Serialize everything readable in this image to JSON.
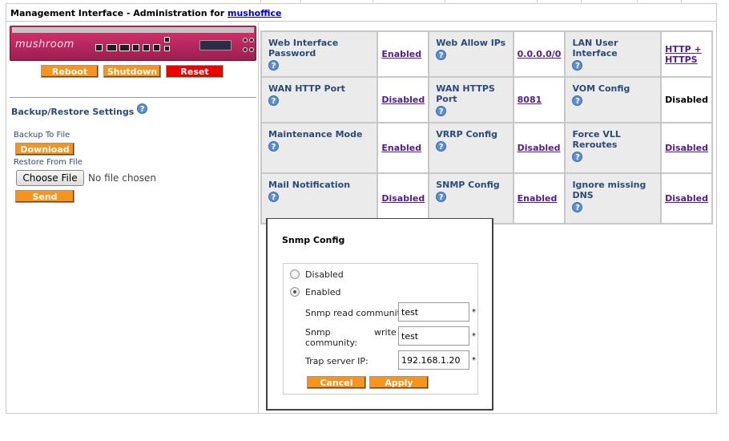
{
  "title": {
    "prefix": "Management Interface - Administration for",
    "host": "mushoffice"
  },
  "device": {
    "brand": "mushroom"
  },
  "device_buttons": {
    "reboot": "Reboot",
    "shutdown": "Shutdown",
    "reset": "Reset"
  },
  "backup": {
    "title": "Backup/Restore Settings",
    "backup_label": "Backup To File",
    "download": "Download",
    "restore_label": "Restore From File",
    "choose_file": "Choose File",
    "no_file": "No file chosen",
    "send": "Send"
  },
  "settings": [
    [
      {
        "name": "Web Interface Password",
        "value": "Enabled"
      },
      {
        "name": "Web Allow IPs",
        "value": "0.0.0.0/0"
      },
      {
        "name": "LAN User Interface",
        "value": "HTTP + HTTPS"
      }
    ],
    [
      {
        "name": "WAN HTTP Port",
        "value": "Disabled"
      },
      {
        "name": "WAN HTTPS Port",
        "value": "8081"
      },
      {
        "name": "VOM Config",
        "value": "Disabled"
      }
    ],
    [
      {
        "name": "Maintenance Mode",
        "value": "Enabled"
      },
      {
        "name": "VRRP Config",
        "value": "Disabled"
      },
      {
        "name": "Force VLL Reroutes",
        "value": "Disabled"
      }
    ],
    [
      {
        "name": "Mail Notification",
        "value": "Disabled"
      },
      {
        "name": "SNMP Config",
        "value": "Enabled"
      },
      {
        "name": "Ignore missing DNS",
        "value": "Disabled"
      }
    ]
  ],
  "help_icon": "?",
  "snmp": {
    "title": "Snmp Config",
    "opt_disabled": "Disabled",
    "opt_enabled": "Enabled",
    "read_label": "Snmp read community:",
    "read_value": "test",
    "write_label_a": "Snmp",
    "write_label_b": "write",
    "write_label_c": "community:",
    "write_value": "test",
    "trap_label": "Trap server IP:",
    "trap_value": "192.168.1.20",
    "required": "*",
    "cancel": "Cancel",
    "apply": "Apply"
  },
  "colors": {
    "accent_orange": "#f7941d",
    "danger_red": "#ee0000",
    "label_blue": "#2b4a7a",
    "link_purple": "#551a8b"
  }
}
